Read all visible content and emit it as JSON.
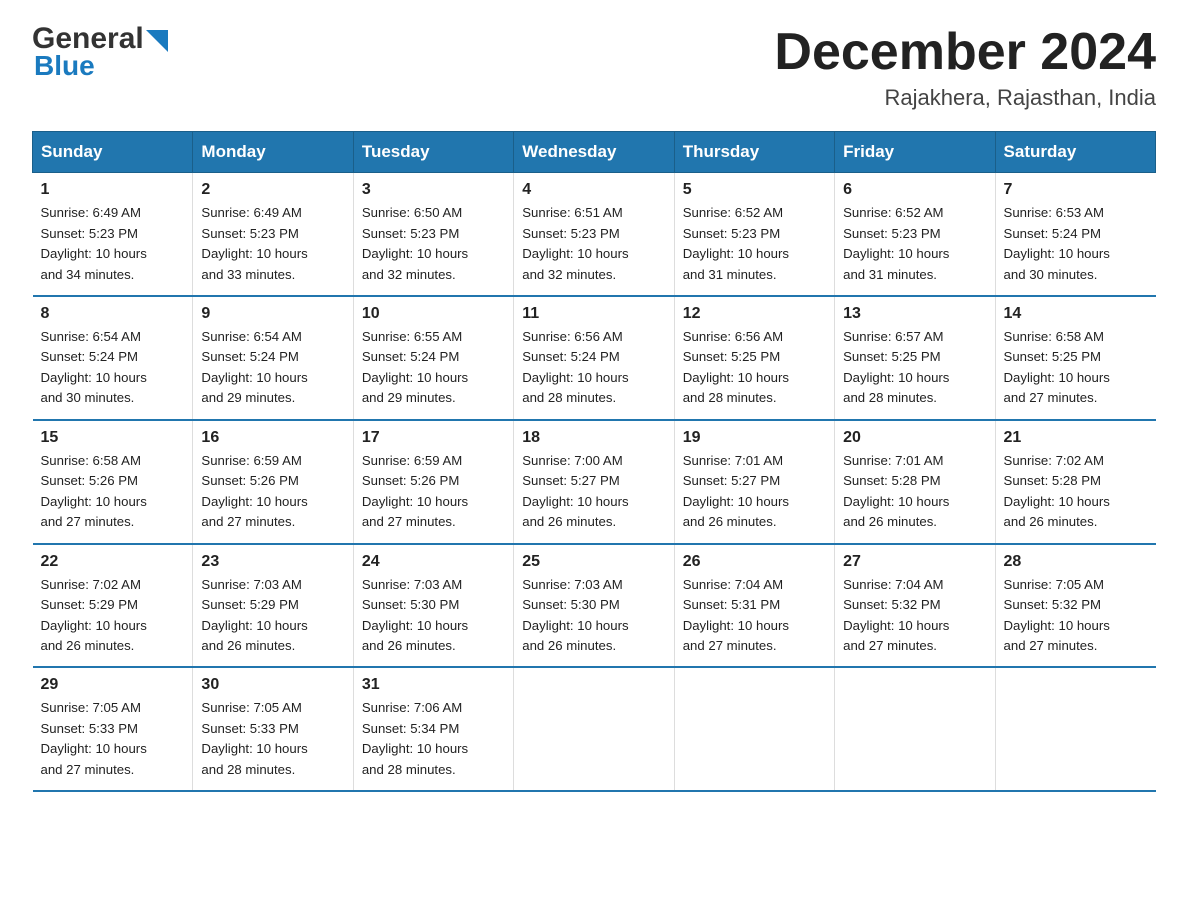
{
  "header": {
    "logo_general": "General",
    "logo_blue": "Blue",
    "month_title": "December 2024",
    "location": "Rajakhera, Rajasthan, India"
  },
  "days_of_week": [
    "Sunday",
    "Monday",
    "Tuesday",
    "Wednesday",
    "Thursday",
    "Friday",
    "Saturday"
  ],
  "weeks": [
    [
      {
        "day": "1",
        "sunrise": "6:49 AM",
        "sunset": "5:23 PM",
        "daylight": "10 hours and 34 minutes."
      },
      {
        "day": "2",
        "sunrise": "6:49 AM",
        "sunset": "5:23 PM",
        "daylight": "10 hours and 33 minutes."
      },
      {
        "day": "3",
        "sunrise": "6:50 AM",
        "sunset": "5:23 PM",
        "daylight": "10 hours and 32 minutes."
      },
      {
        "day": "4",
        "sunrise": "6:51 AM",
        "sunset": "5:23 PM",
        "daylight": "10 hours and 32 minutes."
      },
      {
        "day": "5",
        "sunrise": "6:52 AM",
        "sunset": "5:23 PM",
        "daylight": "10 hours and 31 minutes."
      },
      {
        "day": "6",
        "sunrise": "6:52 AM",
        "sunset": "5:23 PM",
        "daylight": "10 hours and 31 minutes."
      },
      {
        "day": "7",
        "sunrise": "6:53 AM",
        "sunset": "5:24 PM",
        "daylight": "10 hours and 30 minutes."
      }
    ],
    [
      {
        "day": "8",
        "sunrise": "6:54 AM",
        "sunset": "5:24 PM",
        "daylight": "10 hours and 30 minutes."
      },
      {
        "day": "9",
        "sunrise": "6:54 AM",
        "sunset": "5:24 PM",
        "daylight": "10 hours and 29 minutes."
      },
      {
        "day": "10",
        "sunrise": "6:55 AM",
        "sunset": "5:24 PM",
        "daylight": "10 hours and 29 minutes."
      },
      {
        "day": "11",
        "sunrise": "6:56 AM",
        "sunset": "5:24 PM",
        "daylight": "10 hours and 28 minutes."
      },
      {
        "day": "12",
        "sunrise": "6:56 AM",
        "sunset": "5:25 PM",
        "daylight": "10 hours and 28 minutes."
      },
      {
        "day": "13",
        "sunrise": "6:57 AM",
        "sunset": "5:25 PM",
        "daylight": "10 hours and 28 minutes."
      },
      {
        "day": "14",
        "sunrise": "6:58 AM",
        "sunset": "5:25 PM",
        "daylight": "10 hours and 27 minutes."
      }
    ],
    [
      {
        "day": "15",
        "sunrise": "6:58 AM",
        "sunset": "5:26 PM",
        "daylight": "10 hours and 27 minutes."
      },
      {
        "day": "16",
        "sunrise": "6:59 AM",
        "sunset": "5:26 PM",
        "daylight": "10 hours and 27 minutes."
      },
      {
        "day": "17",
        "sunrise": "6:59 AM",
        "sunset": "5:26 PM",
        "daylight": "10 hours and 27 minutes."
      },
      {
        "day": "18",
        "sunrise": "7:00 AM",
        "sunset": "5:27 PM",
        "daylight": "10 hours and 26 minutes."
      },
      {
        "day": "19",
        "sunrise": "7:01 AM",
        "sunset": "5:27 PM",
        "daylight": "10 hours and 26 minutes."
      },
      {
        "day": "20",
        "sunrise": "7:01 AM",
        "sunset": "5:28 PM",
        "daylight": "10 hours and 26 minutes."
      },
      {
        "day": "21",
        "sunrise": "7:02 AM",
        "sunset": "5:28 PM",
        "daylight": "10 hours and 26 minutes."
      }
    ],
    [
      {
        "day": "22",
        "sunrise": "7:02 AM",
        "sunset": "5:29 PM",
        "daylight": "10 hours and 26 minutes."
      },
      {
        "day": "23",
        "sunrise": "7:03 AM",
        "sunset": "5:29 PM",
        "daylight": "10 hours and 26 minutes."
      },
      {
        "day": "24",
        "sunrise": "7:03 AM",
        "sunset": "5:30 PM",
        "daylight": "10 hours and 26 minutes."
      },
      {
        "day": "25",
        "sunrise": "7:03 AM",
        "sunset": "5:30 PM",
        "daylight": "10 hours and 26 minutes."
      },
      {
        "day": "26",
        "sunrise": "7:04 AM",
        "sunset": "5:31 PM",
        "daylight": "10 hours and 27 minutes."
      },
      {
        "day": "27",
        "sunrise": "7:04 AM",
        "sunset": "5:32 PM",
        "daylight": "10 hours and 27 minutes."
      },
      {
        "day": "28",
        "sunrise": "7:05 AM",
        "sunset": "5:32 PM",
        "daylight": "10 hours and 27 minutes."
      }
    ],
    [
      {
        "day": "29",
        "sunrise": "7:05 AM",
        "sunset": "5:33 PM",
        "daylight": "10 hours and 27 minutes."
      },
      {
        "day": "30",
        "sunrise": "7:05 AM",
        "sunset": "5:33 PM",
        "daylight": "10 hours and 28 minutes."
      },
      {
        "day": "31",
        "sunrise": "7:06 AM",
        "sunset": "5:34 PM",
        "daylight": "10 hours and 28 minutes."
      },
      null,
      null,
      null,
      null
    ]
  ],
  "labels": {
    "sunrise": "Sunrise:",
    "sunset": "Sunset:",
    "daylight": "Daylight:"
  }
}
